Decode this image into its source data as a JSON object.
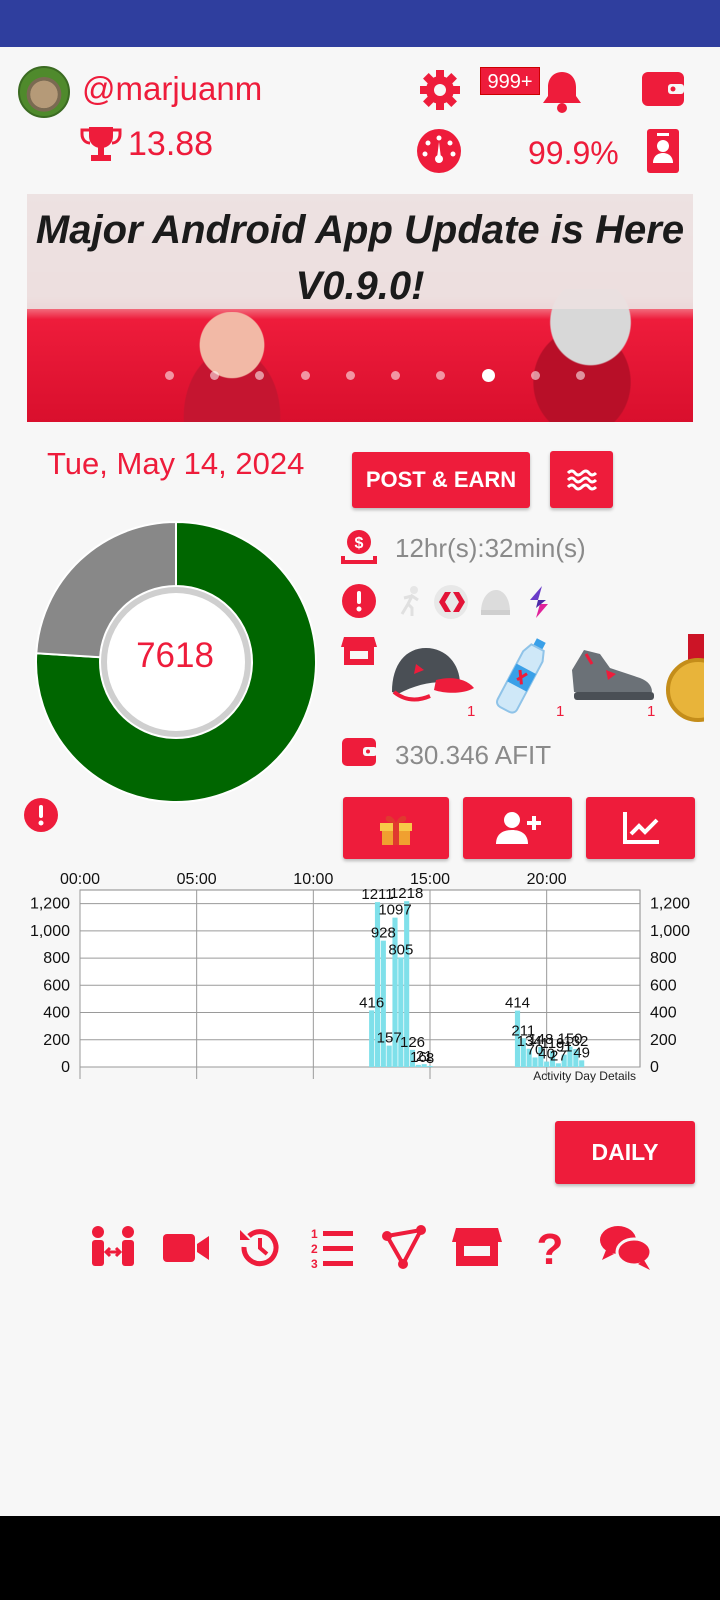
{
  "header": {
    "username": "@marjuanm",
    "score": "13.88",
    "notifications_badge": "999+",
    "percent": "99.9%"
  },
  "banner": {
    "title": "Major Android App Update is Here V0.9.0!",
    "slide_count": 10,
    "active_slide": 8
  },
  "main": {
    "date": "Tue, May 14, 2024",
    "post_earn_label": "POST & EARN",
    "timer": "12hr(s):32min(s)",
    "balance": "330.346 AFIT",
    "daily_label": "DAILY"
  },
  "donut": {
    "center_value": "7618",
    "segments": [
      {
        "name": "progress",
        "fraction": 0.76,
        "color": "#006600"
      },
      {
        "name": "remaining",
        "fraction": 0.24,
        "color": "#888888"
      }
    ]
  },
  "shop": {
    "items": [
      {
        "icon": "cap-icon",
        "count": "1"
      },
      {
        "icon": "water-bottle-icon",
        "count": "1"
      },
      {
        "icon": "sneaker-icon",
        "count": "1"
      },
      {
        "icon": "medal-icon",
        "count": ""
      }
    ]
  },
  "chart_data": {
    "type": "bar",
    "title": "",
    "x_ticks": [
      "00:00",
      "05:00",
      "10:00",
      "15:00",
      "20:00"
    ],
    "xlim": [
      0,
      24
    ],
    "ylim": [
      0,
      1300
    ],
    "y_ticks": [
      "0",
      "200",
      "400",
      "600",
      "800",
      "1,000",
      "1,200"
    ],
    "annotation": "Activity Day Details",
    "bar_color": "#7fe0ea",
    "bars": [
      {
        "x": 12.5,
        "value": 416
      },
      {
        "x": 12.75,
        "value": 1211
      },
      {
        "x": 13.0,
        "value": 928
      },
      {
        "x": 13.25,
        "value": 157
      },
      {
        "x": 13.5,
        "value": 1097
      },
      {
        "x": 13.75,
        "value": 805
      },
      {
        "x": 14.0,
        "value": 1218
      },
      {
        "x": 14.25,
        "value": 126
      },
      {
        "x": 14.5,
        "value": 16
      },
      {
        "x": 14.75,
        "value": 21
      },
      {
        "x": 15.0,
        "value": 8
      },
      {
        "x": 18.75,
        "value": 414
      },
      {
        "x": 19.0,
        "value": 211
      },
      {
        "x": 19.25,
        "value": 134
      },
      {
        "x": 19.5,
        "value": 70
      },
      {
        "x": 19.75,
        "value": 148
      },
      {
        "x": 20.0,
        "value": 40
      },
      {
        "x": 20.25,
        "value": 119
      },
      {
        "x": 20.5,
        "value": 27
      },
      {
        "x": 20.75,
        "value": 91
      },
      {
        "x": 21.0,
        "value": 150
      },
      {
        "x": 21.25,
        "value": 132
      },
      {
        "x": 21.5,
        "value": 49
      }
    ]
  }
}
